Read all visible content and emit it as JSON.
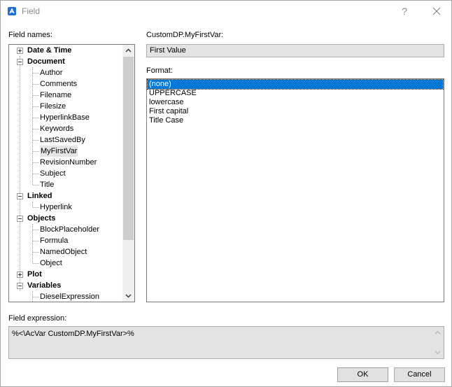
{
  "window": {
    "title": "Field",
    "help_label": "?",
    "icons": {
      "app": "app-logo-icon",
      "close": "close-icon"
    }
  },
  "field_names": {
    "label": "Field names:",
    "tree": [
      {
        "label": "Date & Time",
        "type": "category",
        "expanded": false
      },
      {
        "label": "Document",
        "type": "category",
        "expanded": true
      },
      {
        "label": "Author",
        "type": "leaf"
      },
      {
        "label": "Comments",
        "type": "leaf"
      },
      {
        "label": "Filename",
        "type": "leaf"
      },
      {
        "label": "Filesize",
        "type": "leaf"
      },
      {
        "label": "HyperlinkBase",
        "type": "leaf"
      },
      {
        "label": "Keywords",
        "type": "leaf"
      },
      {
        "label": "LastSavedBy",
        "type": "leaf"
      },
      {
        "label": "MyFirstVar",
        "type": "leaf",
        "selected": true
      },
      {
        "label": "RevisionNumber",
        "type": "leaf"
      },
      {
        "label": "Subject",
        "type": "leaf"
      },
      {
        "label": "Title",
        "type": "leaf"
      },
      {
        "label": "Linked",
        "type": "category",
        "expanded": true
      },
      {
        "label": "Hyperlink",
        "type": "leaf"
      },
      {
        "label": "Objects",
        "type": "category",
        "expanded": true
      },
      {
        "label": "BlockPlaceholder",
        "type": "leaf"
      },
      {
        "label": "Formula",
        "type": "leaf"
      },
      {
        "label": "NamedObject",
        "type": "leaf"
      },
      {
        "label": "Object",
        "type": "leaf"
      },
      {
        "label": "Plot",
        "type": "category",
        "expanded": false
      },
      {
        "label": "Variables",
        "type": "category",
        "expanded": true
      },
      {
        "label": "DieselExpression",
        "type": "leaf"
      }
    ]
  },
  "field_value": {
    "label": "CustomDP.MyFirstVar:",
    "value": "First Value"
  },
  "format": {
    "label": "Format:",
    "options": [
      "(none)",
      "UPPERCASE",
      "lowercase",
      "First capital",
      "Title Case"
    ],
    "selected": "(none)"
  },
  "expression": {
    "label": "Field expression:",
    "value": "%<\\AcVar CustomDP.MyFirstVar>%"
  },
  "buttons": {
    "ok": "OK",
    "cancel": "Cancel"
  }
}
